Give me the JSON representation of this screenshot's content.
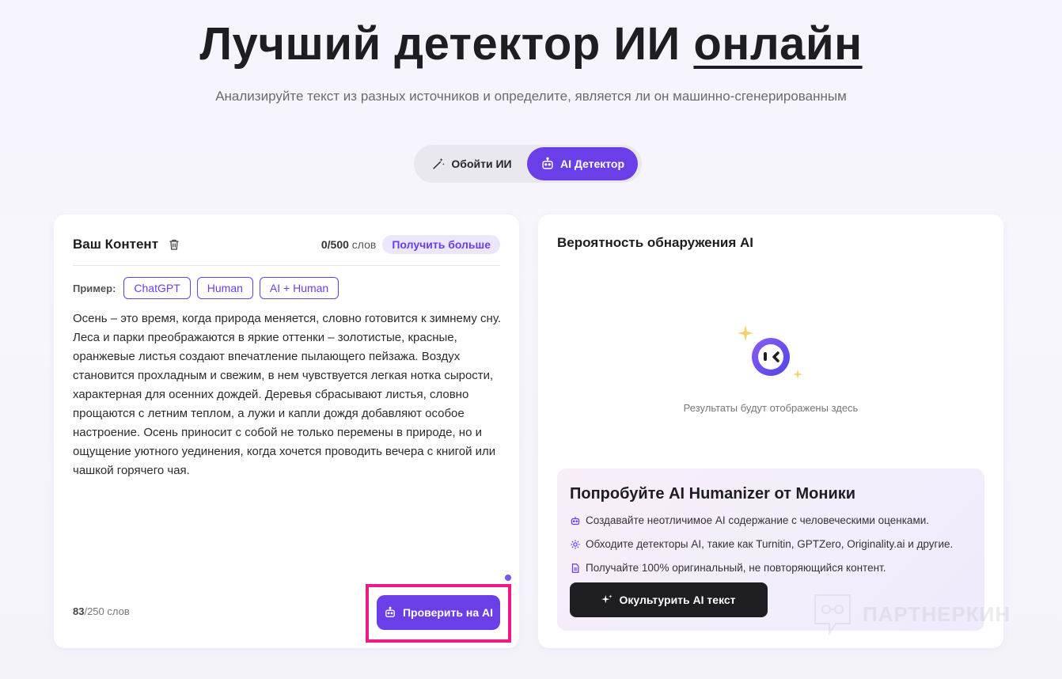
{
  "hero": {
    "title_main": "Лучший детектор ИИ",
    "title_underlined": "онлайн",
    "subtitle": "Анализируйте текст из разных источников и определите, является ли он машинно-сгенерированным"
  },
  "mode_switch": {
    "tabs": [
      {
        "label": "Обойти ИИ",
        "icon": "magic-wand-icon",
        "active": false
      },
      {
        "label": "AI Детектор",
        "icon": "robot-icon",
        "active": true
      }
    ]
  },
  "content_panel": {
    "title": "Ваш Контент",
    "word_count_used": "0",
    "word_count_limit": "/500",
    "word_count_unit": "слов",
    "get_more_label": "Получить больше",
    "examples_label": "Пример:",
    "examples": [
      "ChatGPT",
      "Human",
      "AI + Human"
    ],
    "text": "Осень – это время, когда природа меняется, словно готовится к зимнему сну. Леса и парки преображаются в яркие оттенки – золотистые, красные, оранжевые листья создают впечатление пылающего пейзажа. Воздух становится прохладным и свежим, в нем чувствуется легкая нотка сырости, характерная для осенних дождей. Деревья сбрасывают листья, словно прощаются с летним теплом, а лужи и капли дождя добавляют особое настроение. Осень приносит с собой не только перемены в природе, но и ощущение уютного уединения, когда хочется проводить вечера с книгой или чашкой горячего чая.",
    "bottom_count_value": "83",
    "bottom_count_rest": "/250 слов",
    "check_button_label": "Проверить на AI"
  },
  "result_panel": {
    "title": "Вероятность обнаружения AI",
    "placeholder": "Результаты будут отображены здесь",
    "promo": {
      "title": "Попробуйте AI Humanizer от Моники",
      "items": [
        {
          "icon": "robot-icon",
          "text": "Создавайте неотличимое AI содержание с человеческими оценками."
        },
        {
          "icon": "gear-icon",
          "text": "Обходите детекторы AI, такие как Turnitin, GPTZero, Originality.ai и другие."
        },
        {
          "icon": "document-icon",
          "text": "Получайте 100% оригинальный, не повторяющийся контент."
        }
      ],
      "button_label": "Окультурить AI текст"
    }
  },
  "watermark": {
    "text": "ПАРТНЕРКИН"
  },
  "colors": {
    "accent": "#6a3fe8",
    "highlight": "#ee1b86",
    "dark": "#1d1d22"
  }
}
